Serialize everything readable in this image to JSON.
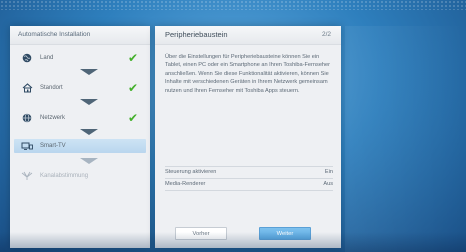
{
  "wizard": {
    "title": "Automatische Installation",
    "steps": [
      {
        "label": "Land",
        "icon": "globe-icon",
        "state": "done"
      },
      {
        "label": "Standort",
        "icon": "house-icon",
        "state": "done"
      },
      {
        "label": "Netzwerk",
        "icon": "network-icon",
        "state": "done"
      },
      {
        "label": "Smart-TV",
        "icon": "smart-tv-icon",
        "state": "active"
      },
      {
        "label": "Kanalabstimmung",
        "icon": "antenna-icon",
        "state": "disabled"
      }
    ],
    "check_mark": "✔"
  },
  "detail": {
    "title": "Peripheriebaustein",
    "page": "2/2",
    "description": "Über die Einstellungen für Peripheriebausteine können Sie ein Tablet, einen PC oder ein Smartphone an Ihren Toshiba-Fernseher anschließen. Wenn Sie diese Funktionalität aktivieren, können Sie Inhalte mit verschiedenen Geräten in Ihrem Netzwerk gemeinsam nutzen und Ihren Fernseher mit Toshiba Apps steuern.",
    "settings": [
      {
        "label": "Steuerung aktivieren",
        "value": "Ein"
      },
      {
        "label": "Media-Renderer",
        "value": "Aus"
      }
    ],
    "prev_label": "Vorher",
    "next_label": "Weiter"
  },
  "colors": {
    "accent": "#5aa8e0",
    "check": "#43b02a",
    "active_row": "#c4dcf1"
  }
}
